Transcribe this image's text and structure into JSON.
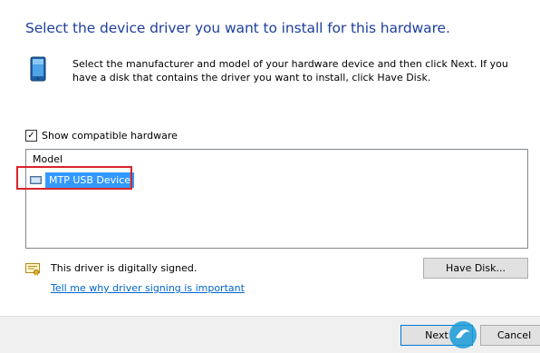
{
  "dialog": {
    "heading": "Select the device driver you want to install for this hardware.",
    "description": "Select the manufacturer and model of your hardware device and then click Next. If you have a disk that contains the driver you want to install, click Have Disk.",
    "device_icon": "device-icon"
  },
  "compatible": {
    "label": "Show compatible hardware",
    "checked": true
  },
  "model_list": {
    "header": "Model",
    "items": [
      {
        "label": "MTP USB Device",
        "selected": true,
        "icon": "driver-icon"
      }
    ]
  },
  "signing": {
    "icon": "certificate-icon",
    "status": "This driver is digitally signed.",
    "link": "Tell me why driver signing is important"
  },
  "buttons": {
    "have_disk": "Have Disk...",
    "next": "Next",
    "cancel": "Cancel"
  },
  "colors": {
    "heading": "#1f3f9e",
    "selection": "#3399ff",
    "highlight_box": "#d8232a",
    "link": "#0066cc"
  }
}
